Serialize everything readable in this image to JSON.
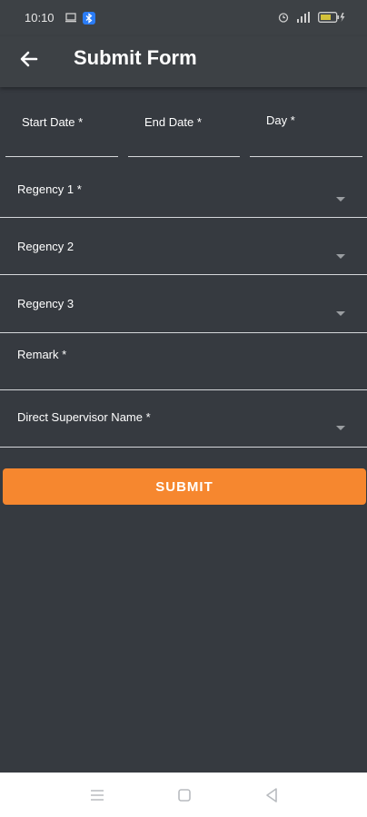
{
  "status_bar": {
    "time": "10:10",
    "icons": [
      "screen-icon",
      "bluetooth-badge-icon",
      "alarm-icon",
      "signal-icon",
      "battery-charging-icon"
    ]
  },
  "app_bar": {
    "title": "Submit Form",
    "back_icon": "arrow-left-icon"
  },
  "form": {
    "start_date_label": "Start Date *",
    "end_date_label": "End Date *",
    "day_label": "Day *",
    "regency1_label": "Regency 1 *",
    "regency2_label": "Regency 2",
    "regency3_label": "Regency 3",
    "remark_label": "Remark *",
    "supervisor_label": "Direct Supervisor Name *"
  },
  "submit_label": "SUBMIT",
  "colors": {
    "background": "#363a40",
    "app_bar": "#3d4145",
    "accent": "#f6872f",
    "underline": "#d5d7da"
  },
  "nav_bar": {
    "icons": [
      "menu-icon",
      "home-square-icon",
      "back-triangle-icon"
    ]
  }
}
